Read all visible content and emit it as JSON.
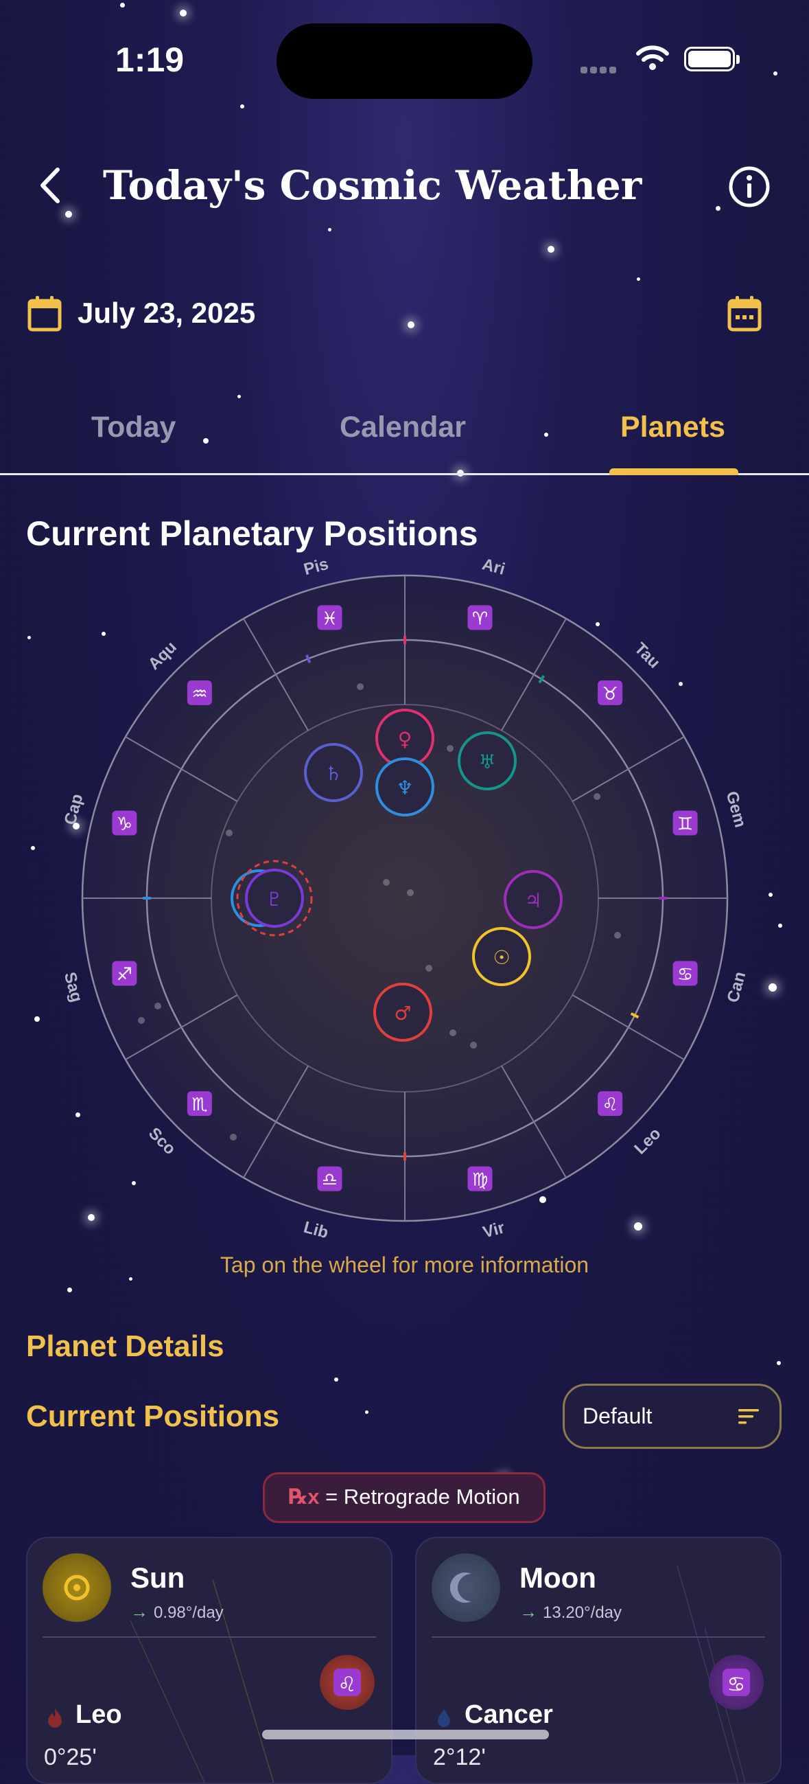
{
  "status_bar": {
    "time": "1:19"
  },
  "header": {
    "title": "Today's Cosmic Weather",
    "back_icon": "chevron-left-icon",
    "info_icon": "info-icon"
  },
  "date_row": {
    "date": "July 23, 2025",
    "date_icon": "calendar-icon",
    "calendar_button_icon": "calendar-grid-icon"
  },
  "tabs": [
    {
      "label": "Today",
      "active": false
    },
    {
      "label": "Calendar",
      "active": false
    },
    {
      "label": "Planets",
      "active": true
    }
  ],
  "section_title": "Current Planetary Positions",
  "wheel": {
    "zodiac": [
      {
        "abbr": "Ari",
        "glyph": "♈"
      },
      {
        "abbr": "Tau",
        "glyph": "♉"
      },
      {
        "abbr": "Gem",
        "glyph": "♊"
      },
      {
        "abbr": "Can",
        "glyph": "♋"
      },
      {
        "abbr": "Leo",
        "glyph": "♌"
      },
      {
        "abbr": "Vir",
        "glyph": "♍"
      },
      {
        "abbr": "Lib",
        "glyph": "♎"
      },
      {
        "abbr": "Sco",
        "glyph": "♏"
      },
      {
        "abbr": "Sag",
        "glyph": "♐"
      },
      {
        "abbr": "Cap",
        "glyph": "♑"
      },
      {
        "abbr": "Aqu",
        "glyph": "♒"
      },
      {
        "abbr": "Pis",
        "glyph": "♓"
      }
    ],
    "planets": [
      {
        "name": "Venus",
        "glyph": "♀",
        "color": "#e0306e"
      },
      {
        "name": "Saturn",
        "glyph": "♄",
        "color": "#5a5fcf"
      },
      {
        "name": "Neptune",
        "glyph": "♆",
        "color": "#2d8fe0"
      },
      {
        "name": "Uranus",
        "glyph": "♅",
        "color": "#14968a"
      },
      {
        "name": "Jupiter",
        "glyph": "♃",
        "color": "#9c2fb8"
      },
      {
        "name": "Sun",
        "glyph": "☉",
        "color": "#f2c22a"
      },
      {
        "name": "Mars",
        "glyph": "♂",
        "color": "#e0403c"
      },
      {
        "name": "Pluto",
        "glyph": "♇",
        "color": "#7a3ad8"
      }
    ],
    "hint": "Tap on the wheel for more information"
  },
  "planet_details_title": "Planet Details",
  "current_positions": {
    "title": "Current Positions",
    "sort_value": "Default",
    "retrograde_symbol": "℞x",
    "retrograde_text": "= Retrograde Motion"
  },
  "cards": [
    {
      "name": "Sun",
      "speed": "0.98°/day",
      "sign": "Leo",
      "sign_glyph": "♌",
      "degree": "0°25'",
      "accent": "#f2c22a"
    },
    {
      "name": "Moon",
      "speed": "13.20°/day",
      "sign": "Cancer",
      "sign_glyph": "♋",
      "degree": "2°12'",
      "accent": "#7d8bb0"
    }
  ]
}
